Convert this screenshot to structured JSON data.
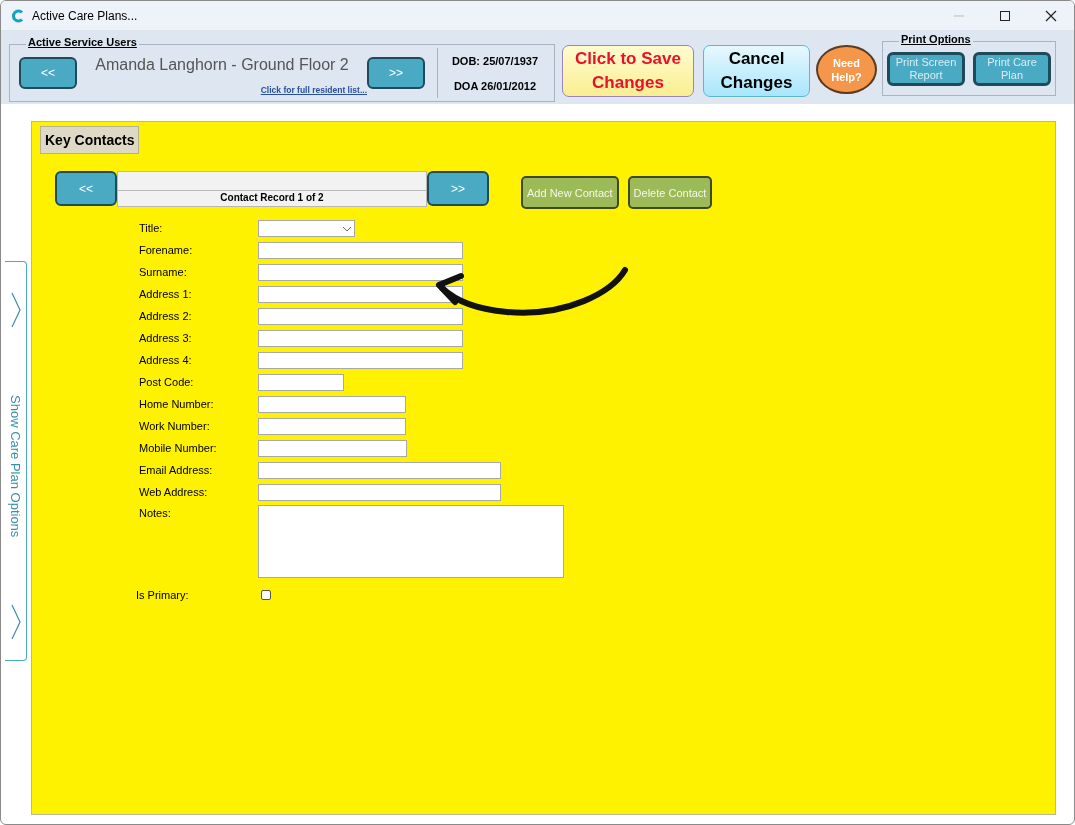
{
  "window": {
    "title": "Active Care Plans..."
  },
  "header": {
    "group_title": "Active Service Users",
    "prev_button": "<<",
    "resident_name": "Amanda Langhorn - Ground Floor 2",
    "resident_list_link": "Click for full resident list...",
    "next_button": ">>",
    "dob": "DOB: 25/07/1937",
    "doa": "DOA 26/01/2012",
    "save_button": "Click to Save Changes",
    "cancel_button": "Cancel Changes",
    "help_button": "Need Help?",
    "print_group_title": "Print Options",
    "print_buttons": [
      "Print Screen Report",
      "Print Care Plan"
    ]
  },
  "side_tab": {
    "label": "Show Care Plan Options"
  },
  "panel": {
    "title": "Key Contacts",
    "prev_button": "<<",
    "record_label": "Contact Record 1 of 2",
    "next_button": ">>",
    "action_buttons": [
      "Add New Contact",
      "Delete Contact"
    ],
    "fields": [
      {
        "kind": "select",
        "label": "Title:"
      },
      {
        "kind": "text",
        "label": "Forename:"
      },
      {
        "kind": "text",
        "label": "Surname:"
      },
      {
        "kind": "text",
        "label": "Address 1:"
      },
      {
        "kind": "text",
        "label": "Address 2:"
      },
      {
        "kind": "text",
        "label": "Address 3:"
      },
      {
        "kind": "text",
        "label": "Address 4:"
      },
      {
        "kind": "text",
        "label": "Post Code:"
      },
      {
        "kind": "text",
        "label": "Home Number:"
      },
      {
        "kind": "text",
        "label": "Work Number:"
      },
      {
        "kind": "text",
        "label": "Mobile Number:"
      },
      {
        "kind": "text",
        "label": "Email Address:"
      },
      {
        "kind": "text",
        "label": "Web Address:"
      },
      {
        "kind": "textarea",
        "label": "Notes:"
      },
      {
        "kind": "checkbox",
        "label": "Is Primary:",
        "checked": false
      }
    ]
  }
}
